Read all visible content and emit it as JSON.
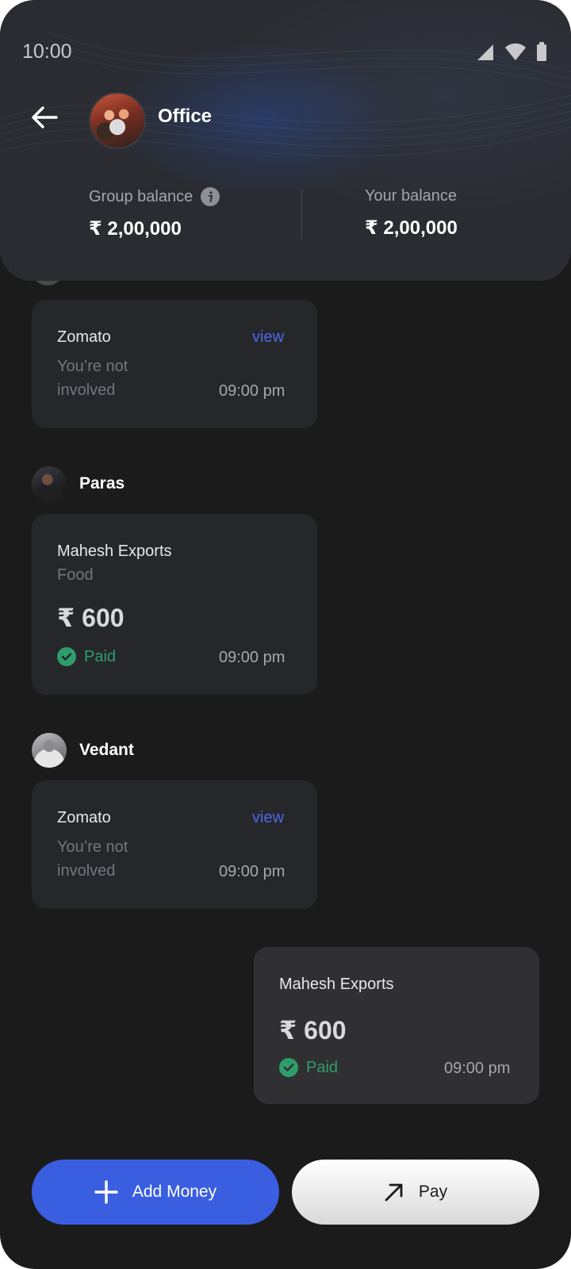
{
  "status_bar": {
    "time": "10:00"
  },
  "header": {
    "title": "Office",
    "group_balance_label": "Group balance",
    "group_balance_value": "₹ 2,00,000",
    "your_balance_label": "Your balance",
    "your_balance_value": "₹ 2,00,000"
  },
  "feed": {
    "card1": {
      "title": "Zomato",
      "link": "view",
      "sub_line1": "You’re not",
      "sub_line2": "involved",
      "time": "09:00 pm"
    },
    "sender2": {
      "name": "Paras"
    },
    "card2": {
      "title": "Mahesh Exports",
      "category": "Food",
      "amount": "₹ 600",
      "status": "Paid",
      "time": "09:00 pm"
    },
    "sender3": {
      "name": "Vedant"
    },
    "card3": {
      "title": "Zomato",
      "link": "view",
      "sub_line1": "You’re not",
      "sub_line2": "involved",
      "time": "09:00 pm"
    },
    "card4": {
      "title": "Mahesh Exports",
      "amount": "₹ 600",
      "status": "Paid",
      "time": "09:00 pm"
    }
  },
  "actions": {
    "add_money_label": "Add Money",
    "add_money_icon": "plus-icon",
    "pay_label": "Pay",
    "pay_icon": "arrow-up-right-icon"
  },
  "colors": {
    "background": "#1b1b1c",
    "card": "#26272b",
    "accent_blue": "#3a5ee0",
    "link_blue": "#4a69e8",
    "paid_green": "#2f9d6a"
  }
}
